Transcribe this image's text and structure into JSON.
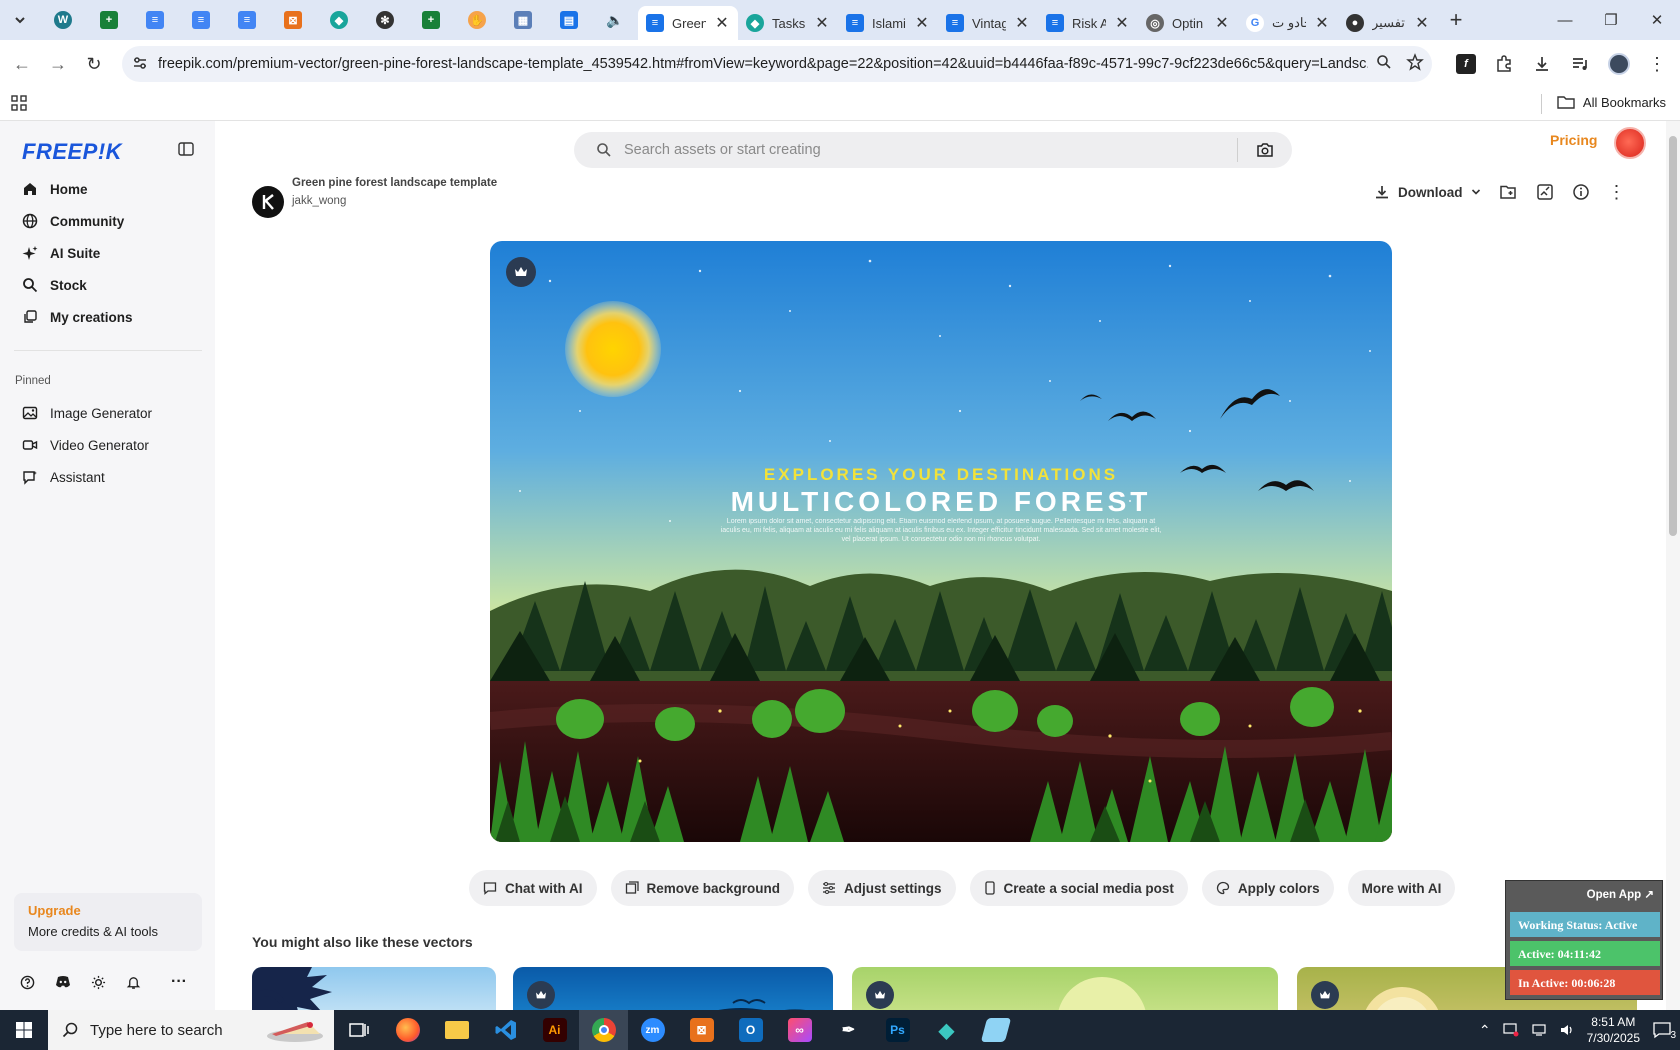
{
  "browser": {
    "tabs": [
      {
        "title": "Green",
        "active": true
      },
      {
        "title": "Tasks"
      },
      {
        "title": "Islami"
      },
      {
        "title": "Vintag"
      },
      {
        "title": "Risk A"
      },
      {
        "title": "Optin"
      },
      {
        "title": "جادو ت"
      },
      {
        "title": "تفسير"
      }
    ],
    "url": "freepik.com/premium-vector/green-pine-forest-landscape-template_4539542.htm#fromView=keyword&page=22&position=42&uuid=b4446faa-f89c-4571-99c7-9cf223de66c5&query=Landsc...",
    "all_bookmarks": "All Bookmarks"
  },
  "sidebar": {
    "logo": "FREEP!K",
    "nav": [
      {
        "label": "Home",
        "icon": "home-icon"
      },
      {
        "label": "Community",
        "icon": "globe-icon"
      },
      {
        "label": "AI Suite",
        "icon": "sparkle-icon"
      },
      {
        "label": "Stock",
        "icon": "search-icon"
      },
      {
        "label": "My creations",
        "icon": "layers-icon"
      }
    ],
    "pinned_label": "Pinned",
    "pinned": [
      {
        "label": "Image Generator",
        "icon": "image-icon"
      },
      {
        "label": "Video Generator",
        "icon": "video-icon"
      },
      {
        "label": "Assistant",
        "icon": "chat-icon"
      }
    ],
    "upgrade_title": "Upgrade",
    "upgrade_sub": "More credits & AI tools"
  },
  "header": {
    "search_placeholder": "Search assets or start creating",
    "pricing": "Pricing"
  },
  "asset": {
    "title": "Green pine forest landscape template",
    "author": "jakk_wong",
    "download_label": "Download"
  },
  "poster": {
    "subtitle": "EXPLORES YOUR DESTINATIONS",
    "title": "MULTICOLORED FOREST",
    "body": "Lorem ipsum dolor sit amet, consectetur adipiscing elit. Etiam euismod eleifend ipsum, at posuere augue. Pellentesque mi felis, aliquam at iaculis eu, mi felis, aliquam at iaculis eu mi felis aliquam at iaculis finibus eu ex. Integer efficitur tincidunt malesuada. Sed sit amet molestie elit, vel placerat ipsum. Ut consectetur odio non mi rhoncus volutpat."
  },
  "ai_actions": [
    "Chat with AI",
    "Remove background",
    "Adjust settings",
    "Create a social media post",
    "Apply colors",
    "More with AI"
  ],
  "similar_title": "You might also like these vectors",
  "overlay": {
    "open_app": "Open App",
    "status": "Working Status: Active",
    "active": "Active: 04:11:42",
    "inactive": "In Active: 00:06:28"
  },
  "taskbar": {
    "search_placeholder": "Type here to search",
    "time": "8:51 AM",
    "date": "7/30/2025",
    "notifications": "3"
  }
}
